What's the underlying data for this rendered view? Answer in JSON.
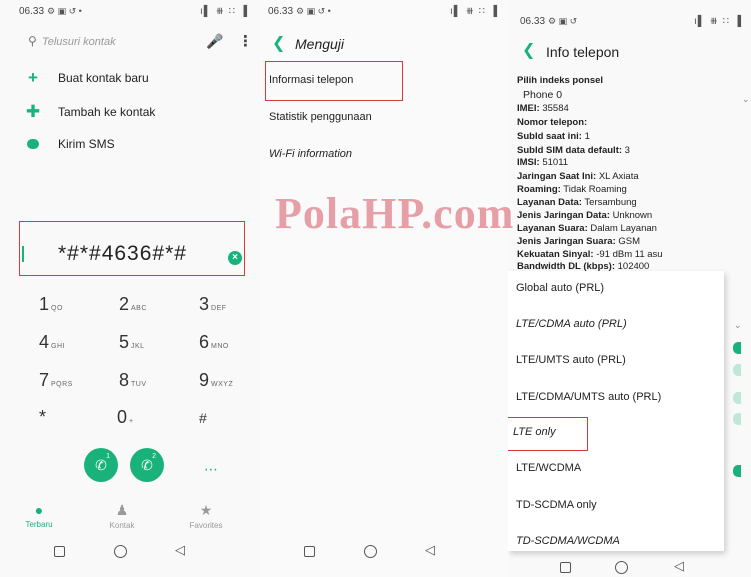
{
  "panel1": {
    "status": {
      "time": "06.33",
      "icons": "⚙ ▣ ↺ •",
      "right": "ı▌ ⧻ ∷ ▐"
    },
    "search": {
      "placeholder": "Telusuri kontak"
    },
    "actions": [
      {
        "label": "Buat kontak baru",
        "icon": "plus-icon"
      },
      {
        "label": "Tambah ke kontak",
        "icon": "add-person-icon"
      },
      {
        "label": "Kirim SMS",
        "icon": "message-icon"
      }
    ],
    "dialed": "*#*#4636#*#",
    "keys": [
      {
        "num": "1",
        "letters": "QO"
      },
      {
        "num": "2",
        "letters": "ABC"
      },
      {
        "num": "3",
        "letters": "DEF"
      },
      {
        "num": "4",
        "letters": "GHI"
      },
      {
        "num": "5",
        "letters": "JKL"
      },
      {
        "num": "6",
        "letters": "MNO"
      },
      {
        "num": "7",
        "letters": "PQRS"
      },
      {
        "num": "8",
        "letters": "TUV"
      },
      {
        "num": "9",
        "letters": "WXYZ"
      },
      {
        "num": "*",
        "letters": ""
      },
      {
        "num": "0",
        "letters": "+"
      },
      {
        "num": "#",
        "letters": ""
      }
    ],
    "calls": [
      {
        "sim": "1"
      },
      {
        "sim": "2"
      }
    ],
    "tabs": [
      {
        "label": "Terbaru",
        "color": "#19b27b"
      },
      {
        "label": "Kontak",
        "color": "#9a9a9a"
      },
      {
        "label": "Favorites",
        "color": "#9a9a9a"
      }
    ]
  },
  "panel2": {
    "status": {
      "time": "06.33",
      "icons": "⚙ ▣ ↺ •",
      "right": "ı▌ ⧻ ∷ ▐"
    },
    "title": "Menguji",
    "items": [
      "Informasi telepon",
      "Statistik penggunaan",
      "Wi-Fi information"
    ]
  },
  "panel3": {
    "status": {
      "time": "06.33",
      "icons": "⚙ ▣ ↺",
      "right": "ı▌ ⧻ ∷ ▐"
    },
    "title": "Info telepon",
    "info": [
      {
        "label": "Pilih indeks ponsel",
        "value": ""
      },
      {
        "label": "",
        "value": "Phone 0"
      },
      {
        "label": "IMEI:",
        "value": "35584"
      },
      {
        "label": "Nomor telepon:",
        "value": ""
      },
      {
        "label": "SubId saat ini:",
        "value": "1"
      },
      {
        "label": "SubId SIM data default:",
        "value": "3"
      },
      {
        "label": "IMSI:",
        "value": "51011"
      },
      {
        "label": "Jaringan Saat Ini:",
        "value": "XL Axiata"
      },
      {
        "label": "Roaming:",
        "value": "Tidak Roaming"
      },
      {
        "label": "Layanan Data:",
        "value": "Tersambung"
      },
      {
        "label": "Jenis Jaringan Data:",
        "value": "Unknown"
      },
      {
        "label": "Layanan Suara:",
        "value": "Dalam Layanan"
      },
      {
        "label": "Jenis Jaringan Suara:",
        "value": "GSM"
      },
      {
        "label": "Kekuatan Sinyal:",
        "value": "-91 dBm   11 asu"
      },
      {
        "label": "Bandwidth DL (kbps):",
        "value": "102400"
      }
    ],
    "options": [
      "Global auto (PRL)",
      "LTE/CDMA auto (PRL)",
      "LTE/UMTS auto (PRL)",
      "LTE/CDMA/UMTS auto (PRL)",
      "LTE only",
      "LTE/WCDMA",
      "TD-SCDMA only",
      "TD-SCDMA/WCDMA"
    ],
    "selected_option": "LTE only"
  },
  "watermark": "PolaHP.com",
  "colors": {
    "accent": "#19b27b",
    "highlight": "#d63a3a",
    "watermark": "#d65462"
  }
}
